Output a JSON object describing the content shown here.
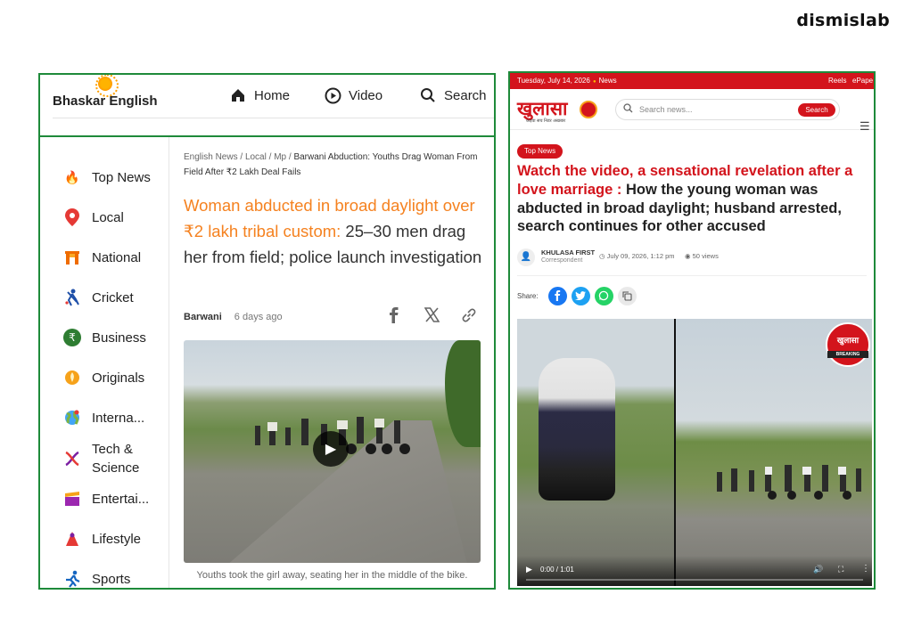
{
  "brand": "dismislab",
  "left": {
    "logo": "Bhaskar English",
    "nav": [
      {
        "label": "Home",
        "icon": "home-icon"
      },
      {
        "label": "Video",
        "icon": "play-circle-icon"
      },
      {
        "label": "Search",
        "icon": "search-icon"
      }
    ],
    "sidebar": [
      {
        "label": "Top News",
        "icon": "fire-icon",
        "color": "#ff6d00"
      },
      {
        "label": "Local",
        "icon": "location-pin-icon",
        "color": "#e53935"
      },
      {
        "label": "National",
        "icon": "india-gate-icon",
        "color": "#ef6c00"
      },
      {
        "label": "Cricket",
        "icon": "cricket-icon",
        "color": "#1e4fa8"
      },
      {
        "label": "Business",
        "icon": "rupee-icon",
        "color": "#2e7d32"
      },
      {
        "label": "Originals",
        "icon": "originals-icon",
        "color": "#f6a21a"
      },
      {
        "label": "Interna...",
        "icon": "globe-icon",
        "color": "#7cb342"
      },
      {
        "label": "Tech & Science",
        "icon": "dna-icon",
        "color": "#7b1fa2"
      },
      {
        "label": "Entertai...",
        "icon": "clapperboard-icon",
        "color": "#9c27b0"
      },
      {
        "label": "Lifestyle",
        "icon": "lifestyle-icon",
        "color": "#e53935"
      },
      {
        "label": "Sports",
        "icon": "runner-icon",
        "color": "#1565c0"
      }
    ],
    "breadcrumb": {
      "items": [
        "English News",
        "Local",
        "Mp"
      ],
      "separator": "/",
      "current": "Barwani Abduction: Youths Drag Woman From Field After ₹2 Lakh Deal Fails"
    },
    "headline_highlight": "Woman abducted in broad daylight over ₹2 lakh tribal custom:",
    "headline_rest": " 25–30 men drag her from field; police launch investigation",
    "author": "Barwani",
    "time_ago": "6 days ago",
    "share_icons": [
      "facebook-icon",
      "x-icon",
      "link-icon"
    ],
    "video_caption": "Youths took the girl away, seating her in the middle of the bike."
  },
  "right": {
    "topbar": {
      "date": "Tuesday, July 14, 2026",
      "news": "News",
      "reels": "Reels",
      "epaper": "ePape"
    },
    "logo": "खुलासा",
    "logo_sub": "कड़वा सच निडर अखबार",
    "search_placeholder": "Search news...",
    "search_button": "Search",
    "tag": "Top News",
    "title_red": "Watch the video, a sensational revelation after a love marriage : ",
    "title_black": "How the young woman was abducted in broad daylight; husband arrested, search continues for other accused",
    "author_name": "KHULASA FIRST",
    "author_role": "Correspondent",
    "date": "July 09, 2026, 1:12 pm",
    "views": "50 views",
    "share_label": "Share:",
    "share_buttons": [
      {
        "icon": "facebook-icon",
        "color": "#1877f2"
      },
      {
        "icon": "twitter-icon",
        "color": "#1da1f2"
      },
      {
        "icon": "whatsapp-icon",
        "color": "#25d366"
      },
      {
        "icon": "copy-icon",
        "color": "#e9e9e9"
      }
    ],
    "video_badge": "खुलासा",
    "video_badge_sub": "BREAKING",
    "video_time": "0:00 / 1:01"
  }
}
